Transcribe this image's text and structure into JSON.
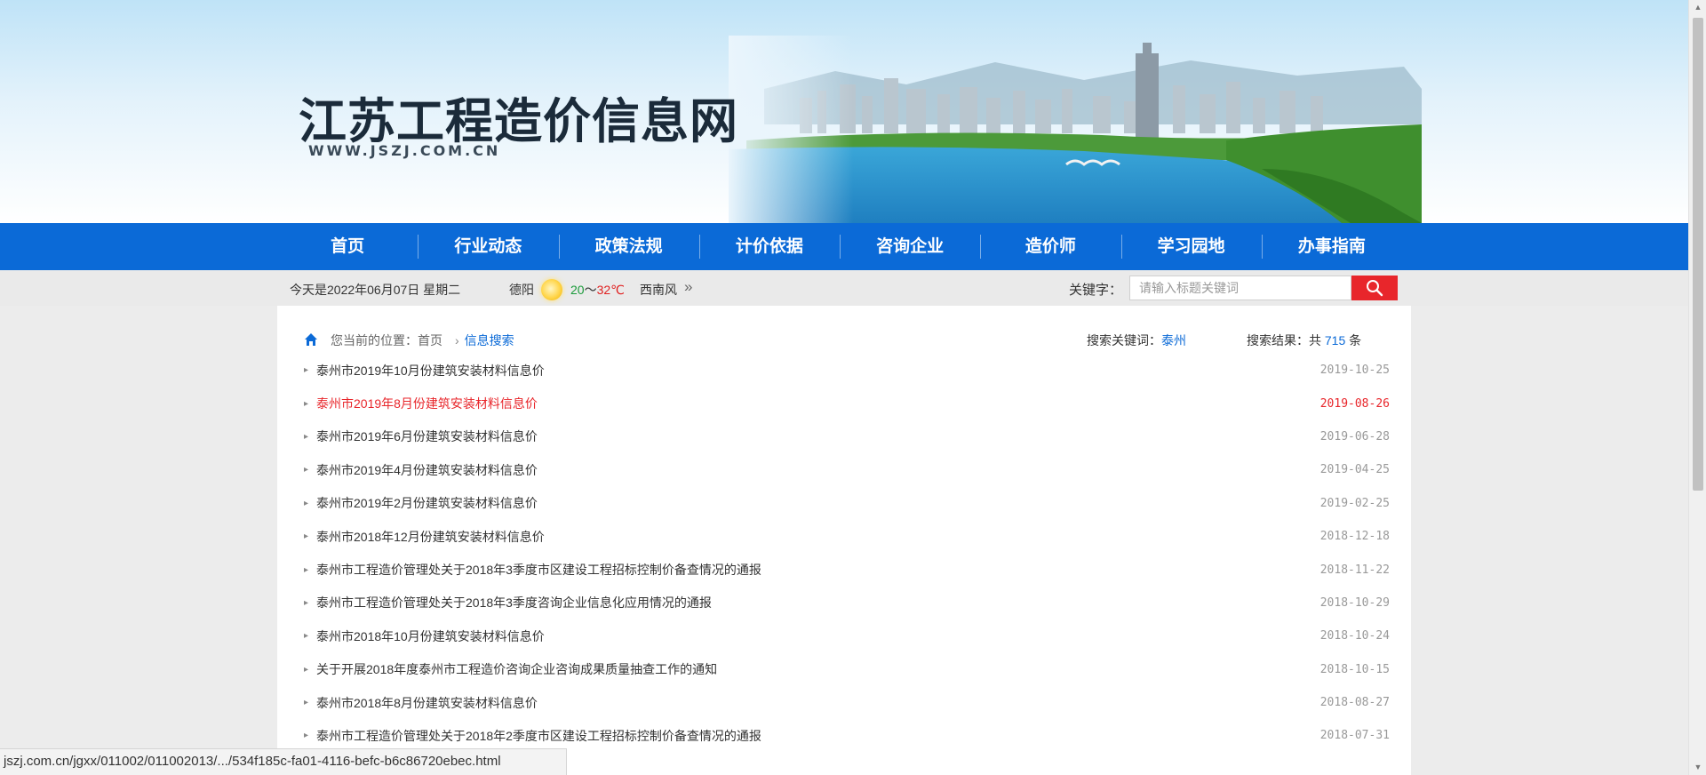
{
  "banner": {
    "title": "江苏工程造价信息网",
    "url": "WWW.JSZJ.COM.CN"
  },
  "nav": {
    "items": [
      {
        "label": "首页"
      },
      {
        "label": "行业动态"
      },
      {
        "label": "政策法规"
      },
      {
        "label": "计价依据"
      },
      {
        "label": "咨询企业"
      },
      {
        "label": "造价师"
      },
      {
        "label": "学习园地"
      },
      {
        "label": "办事指南"
      }
    ]
  },
  "infobar": {
    "date": "今天是2022年06月07日  星期二",
    "city": "德阳",
    "weather_icon": "sun-icon",
    "temp_low": "20",
    "temp_sep": "～",
    "temp_high": "32℃",
    "wind": "西南风",
    "more_glyph": "»",
    "keyword_label": "关键字：",
    "search_placeholder": "请输入标题关键词",
    "search_value": ""
  },
  "breadcrumb": {
    "prefix": "您当前的位置：首页",
    "separator": "›",
    "current": "信息搜索"
  },
  "search_summary": {
    "keyword_label": "搜索关键词：",
    "keyword": "泰州",
    "result_label": "搜索结果：共",
    "count": "715",
    "unit": "条"
  },
  "colors": {
    "nav_blue": "#0b6ad7",
    "accent_red": "#e8262b",
    "link_blue": "#0b6ad7"
  },
  "results": [
    {
      "title": "泰州市2019年10月份建筑安装材料信息价",
      "date": "2019-10-25",
      "highlight": false
    },
    {
      "title": "泰州市2019年8月份建筑安装材料信息价",
      "date": "2019-08-26",
      "highlight": true
    },
    {
      "title": "泰州市2019年6月份建筑安装材料信息价",
      "date": "2019-06-28",
      "highlight": false
    },
    {
      "title": "泰州市2019年4月份建筑安装材料信息价",
      "date": "2019-04-25",
      "highlight": false
    },
    {
      "title": "泰州市2019年2月份建筑安装材料信息价",
      "date": "2019-02-25",
      "highlight": false
    },
    {
      "title": "泰州市2018年12月份建筑安装材料信息价",
      "date": "2018-12-18",
      "highlight": false
    },
    {
      "title": "泰州市工程造价管理处关于2018年3季度市区建设工程招标控制价备查情况的通报",
      "date": "2018-11-22",
      "highlight": false
    },
    {
      "title": "泰州市工程造价管理处关于2018年3季度咨询企业信息化应用情况的通报",
      "date": "2018-10-29",
      "highlight": false
    },
    {
      "title": "泰州市2018年10月份建筑安装材料信息价",
      "date": "2018-10-24",
      "highlight": false
    },
    {
      "title": "关于开展2018年度泰州市工程造价咨询企业咨询成果质量抽查工作的通知",
      "date": "2018-10-15",
      "highlight": false
    },
    {
      "title": "泰州市2018年8月份建筑安装材料信息价",
      "date": "2018-08-27",
      "highlight": false
    },
    {
      "title": "泰州市工程造价管理处关于2018年2季度市区建设工程招标控制价备查情况的通报",
      "date": "2018-07-31",
      "highlight": false
    }
  ],
  "statusbar": {
    "url": "jszj.com.cn/jgxx/011002/011002013/.../534f185c-fa01-4116-befc-b6c86720ebec.html"
  }
}
